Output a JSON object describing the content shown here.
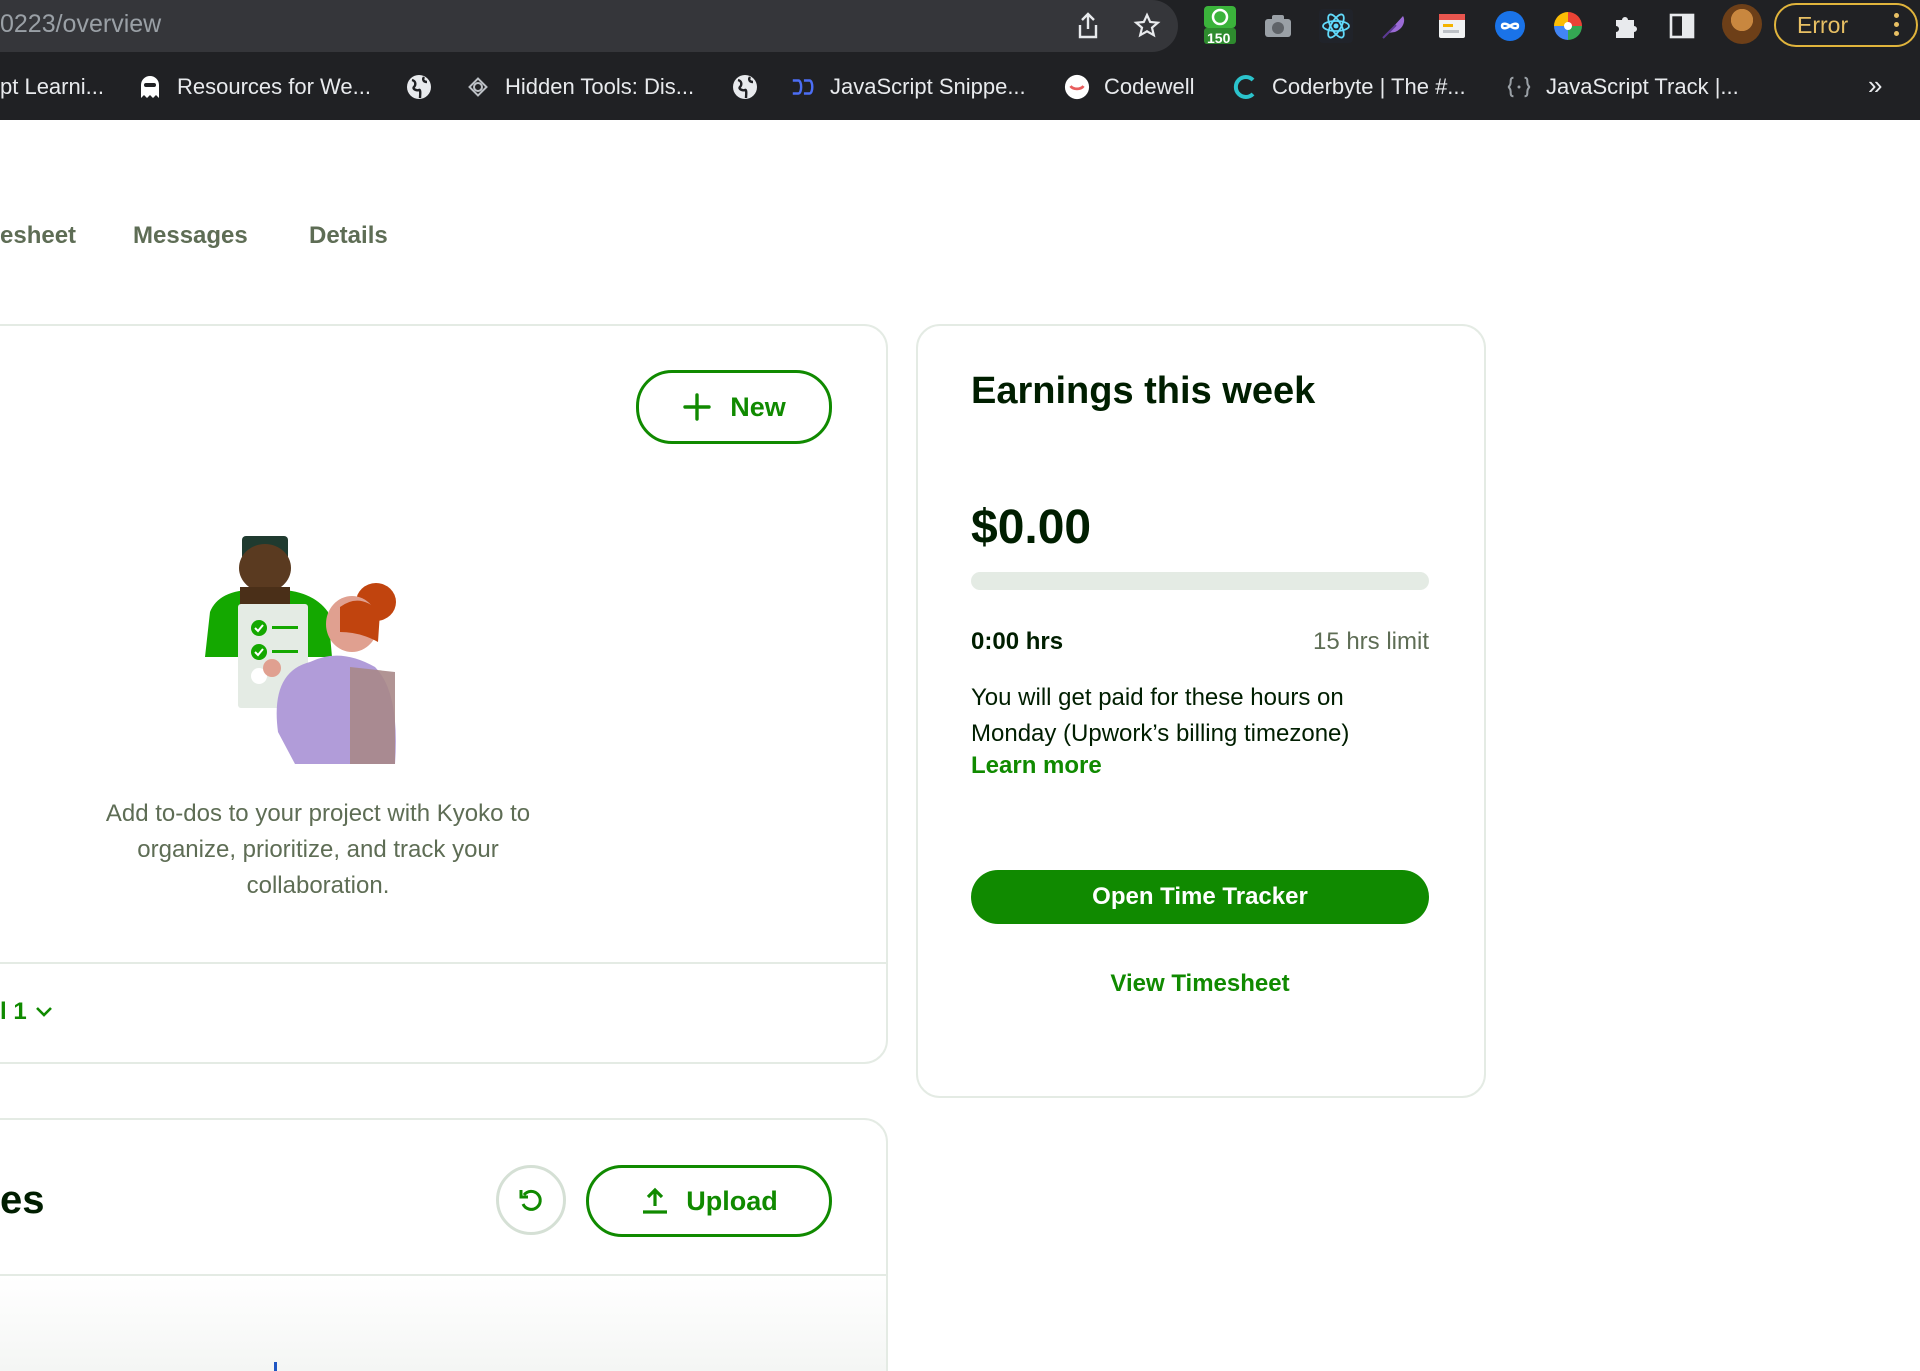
{
  "browser": {
    "url": "0223/overview",
    "extension_badge": "150",
    "profile_status": "Error",
    "bookmarks": [
      {
        "label": "pt Learni...",
        "icon": "page-icon"
      },
      {
        "label": "Resources for We...",
        "icon": "ghost-icon"
      },
      {
        "label": "",
        "icon": "globe-icon"
      },
      {
        "label": "Hidden Tools: Dis...",
        "icon": "hidden-tools-icon"
      },
      {
        "label": "",
        "icon": "globe-icon"
      },
      {
        "label": "JavaScript Snippe...",
        "icon": "snippets-icon"
      },
      {
        "label": "Codewell",
        "icon": "codewell-icon"
      },
      {
        "label": "Coderbyte | The #...",
        "icon": "coderbyte-icon"
      },
      {
        "label": "JavaScript Track |...",
        "icon": "code-braces-icon"
      }
    ],
    "more_bookmarks": "»"
  },
  "tabs": [
    "esheet",
    "Messages",
    "Details"
  ],
  "todos": {
    "new_label": "New",
    "empty_message": "Add to-dos to your project with Kyoko to organize, prioritize, and track your collaboration.",
    "filter_label": "l 1"
  },
  "earnings": {
    "title": "Earnings this week",
    "amount": "$0.00",
    "progress_fraction": 0,
    "hours": "0:00 hrs",
    "limit": "15 hrs limit",
    "paid_text": "You will get paid for these hours on Monday (Upwork’s billing timezone)",
    "learn_more": "Learn more",
    "open_tracker": "Open Time Tracker",
    "view_timesheet": "View Timesheet"
  },
  "files": {
    "heading": "es",
    "upload_label": "Upload"
  },
  "colors": {
    "brand_green": "#108a00",
    "text_dark": "#001e00",
    "text_muted": "#5e6d55",
    "border": "#e4ebe4"
  }
}
